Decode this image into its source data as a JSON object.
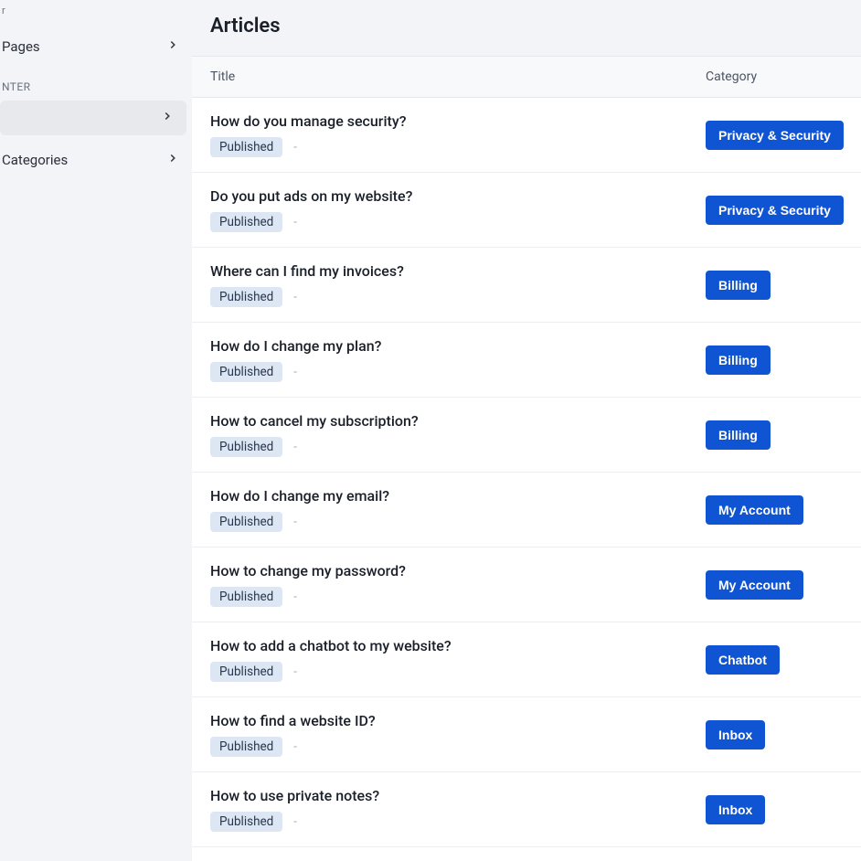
{
  "sidebar": {
    "top_item_cut": "r",
    "pages_label": "Pages",
    "section_label": "NTER",
    "active_item_label": "",
    "categories_label": "Categories"
  },
  "header": {
    "title": "Articles"
  },
  "table": {
    "col_title": "Title",
    "col_category": "Category"
  },
  "status_label": "Published",
  "meta_dash": "-",
  "articles": [
    {
      "title": "How do you manage security?",
      "category": "Privacy & Security"
    },
    {
      "title": "Do you put ads on my website?",
      "category": "Privacy & Security"
    },
    {
      "title": "Where can I find my invoices?",
      "category": "Billing"
    },
    {
      "title": "How do I change my plan?",
      "category": "Billing"
    },
    {
      "title": "How to cancel my subscription?",
      "category": "Billing"
    },
    {
      "title": "How do I change my email?",
      "category": "My Account"
    },
    {
      "title": "How to change my password?",
      "category": "My Account"
    },
    {
      "title": "How to add a chatbot to my website?",
      "category": "Chatbot"
    },
    {
      "title": "How to find a website ID?",
      "category": "Inbox"
    },
    {
      "title": "How to use private notes?",
      "category": "Inbox"
    }
  ]
}
